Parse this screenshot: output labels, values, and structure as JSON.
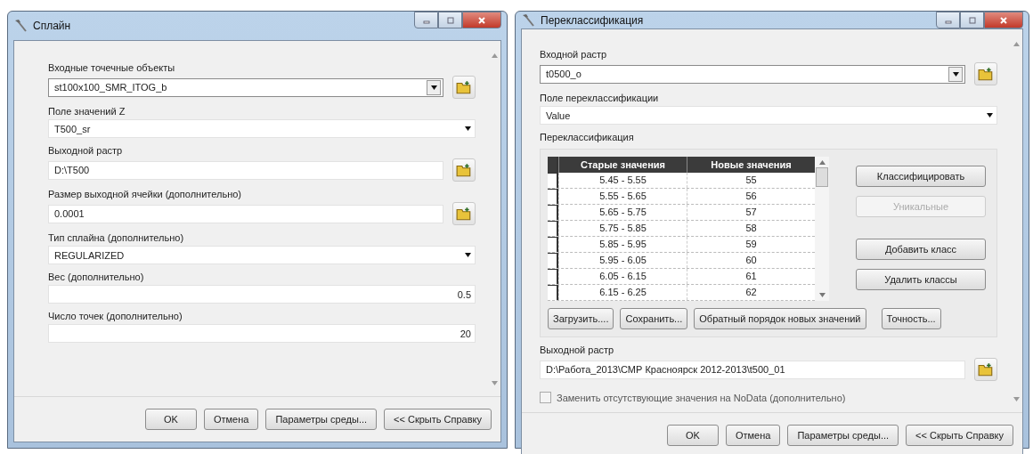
{
  "spline_window": {
    "title": "Сплайн",
    "fields": [
      {
        "label": "Входные точечные объекты",
        "value": "st100x100_SMR_ITOG_b",
        "kind": "combo",
        "browse": true
      },
      {
        "label": "Поле значений Z",
        "value": "T500_sr",
        "kind": "dropdown",
        "browse": false
      },
      {
        "label": "Выходной растр",
        "value": "D:\\T500",
        "kind": "text",
        "browse": true
      },
      {
        "label": "Размер выходной ячейки (дополнительно)",
        "value": "0.0001",
        "kind": "text",
        "browse": true
      },
      {
        "label": "Тип сплайна (дополнительно)",
        "value": "REGULARIZED",
        "kind": "dropdown",
        "browse": false
      },
      {
        "label": "Вес (дополнительно)",
        "value": "0.5",
        "kind": "number",
        "browse": false
      },
      {
        "label": "Число точек (дополнительно)",
        "value": "20",
        "kind": "number",
        "browse": false
      }
    ],
    "buttons": [
      "OK",
      "Отмена",
      "Параметры среды...",
      "<< Скрыть Справку"
    ]
  },
  "reclass_window": {
    "title": "Переклассификация",
    "fields": [
      {
        "label": "Входной растр",
        "value": "t0500_o",
        "kind": "combo",
        "browse": true
      },
      {
        "label": "Поле переклассификации",
        "value": "Value",
        "kind": "dropdown",
        "browse": false
      }
    ],
    "table_label": "Переклассификация",
    "table": {
      "columns": [
        "Старые значения",
        "Новые значения"
      ],
      "rows": [
        [
          "5.45 - 5.55",
          "55"
        ],
        [
          "5.55 - 5.65",
          "56"
        ],
        [
          "5.65 - 5.75",
          "57"
        ],
        [
          "5.75 - 5.85",
          "58"
        ],
        [
          "5.85 - 5.95",
          "59"
        ],
        [
          "5.95 - 6.05",
          "60"
        ],
        [
          "6.05 - 6.15",
          "61"
        ],
        [
          "6.15 - 6.25",
          "62"
        ]
      ]
    },
    "side_buttons": [
      {
        "label": "Классифицировать",
        "disabled": false
      },
      {
        "label": "Уникальные",
        "disabled": true
      },
      {
        "label": "Добавить класс",
        "disabled": false
      },
      {
        "label": "Удалить классы",
        "disabled": false
      }
    ],
    "table_buttons": [
      "Загрузить....",
      "Сохранить...",
      "Обратный порядок новых значений",
      "Точность..."
    ],
    "output": {
      "label": "Выходной растр",
      "value": "D:\\Работа_2013\\СМР Красноярск 2012-2013\\t500_01",
      "browse": true
    },
    "nodata": {
      "label": "Заменить отсутствующие значения на NoData (дополнительно)",
      "checked": false
    },
    "buttons": [
      "OK",
      "Отмена",
      "Параметры среды...",
      "<< Скрыть Справку"
    ]
  }
}
